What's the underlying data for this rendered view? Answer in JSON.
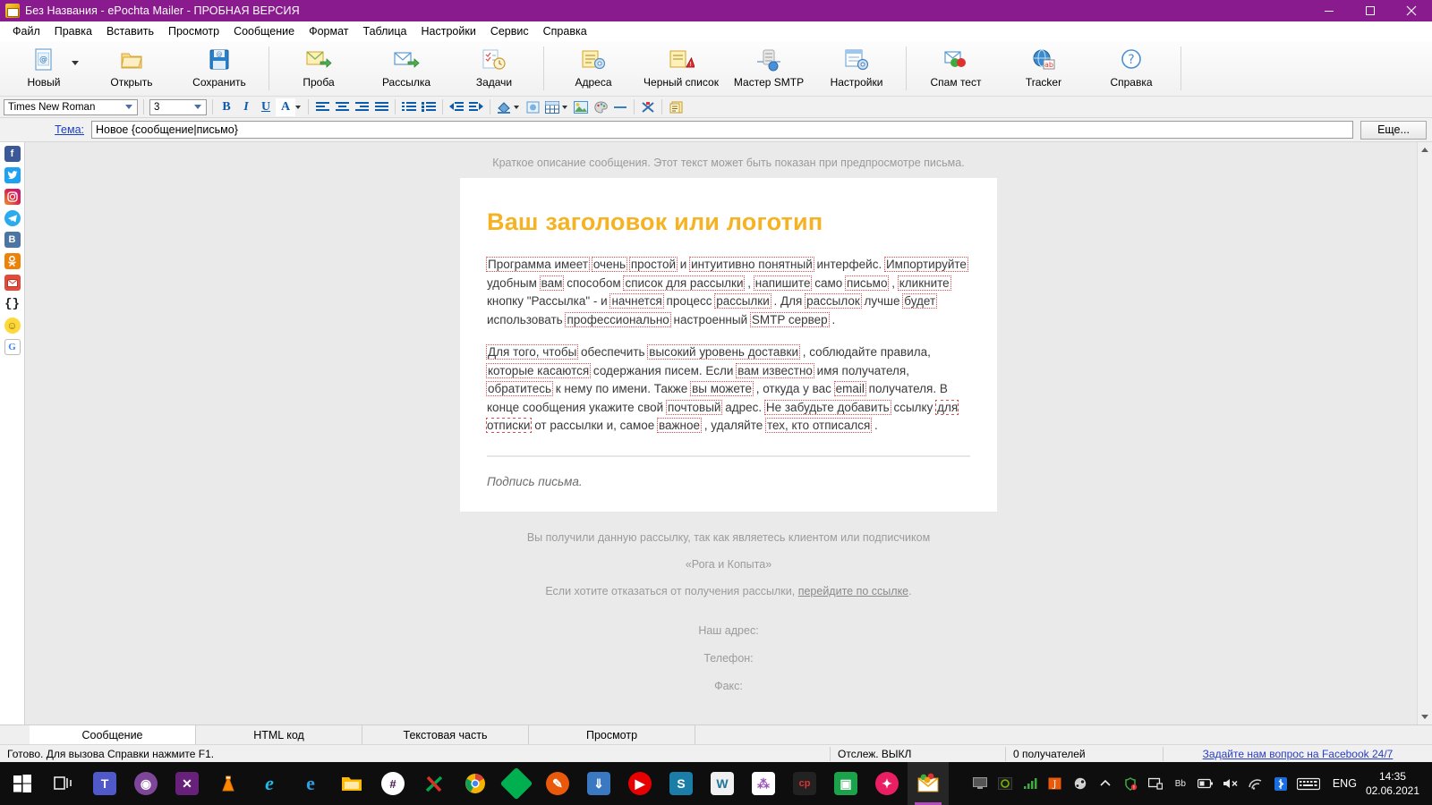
{
  "window": {
    "title": "Без Названия - ePochta Mailer - ПРОБНАЯ ВЕРСИЯ",
    "accent_color": "#8a1b8e",
    "minimize_label": "—",
    "maximize_label": "▢",
    "close_label": "✕"
  },
  "menu": {
    "items": [
      {
        "label": "Файл"
      },
      {
        "label": "Правка"
      },
      {
        "label": "Вставить"
      },
      {
        "label": "Просмотр"
      },
      {
        "label": "Сообщение"
      },
      {
        "label": "Формат"
      },
      {
        "label": "Таблица"
      },
      {
        "label": "Настройки"
      },
      {
        "label": "Сервис"
      },
      {
        "label": "Справка"
      }
    ]
  },
  "toolbar": {
    "groups": [
      {
        "items": [
          {
            "label": "Новый",
            "icon": "new-document-icon",
            "has_dropdown": true
          },
          {
            "label": "Открыть",
            "icon": "open-folder-icon",
            "has_dropdown": false
          },
          {
            "label": "Сохранить",
            "icon": "save-diskette-icon",
            "has_dropdown": false
          }
        ]
      },
      {
        "items": [
          {
            "label": "Проба",
            "icon": "test-send-icon",
            "has_dropdown": false
          },
          {
            "label": "Рассылка",
            "icon": "send-envelope-icon",
            "has_dropdown": false
          },
          {
            "label": "Задачи",
            "icon": "tasks-clock-icon",
            "has_dropdown": false
          }
        ]
      },
      {
        "items": [
          {
            "label": "Адреса",
            "icon": "address-book-icon",
            "has_dropdown": false
          },
          {
            "label": "Черный список",
            "icon": "blacklist-warning-icon",
            "has_dropdown": false
          },
          {
            "label": "Мастер SMTP",
            "icon": "smtp-server-icon",
            "has_dropdown": false
          },
          {
            "label": "Настройки",
            "icon": "settings-gear-icon",
            "has_dropdown": false
          }
        ]
      },
      {
        "items": [
          {
            "label": "Спам тест",
            "icon": "spam-test-icon",
            "has_dropdown": false
          },
          {
            "label": "Tracker",
            "icon": "tracker-globe-icon",
            "has_dropdown": false
          },
          {
            "label": "Справка",
            "icon": "help-question-icon",
            "has_dropdown": false
          }
        ]
      }
    ]
  },
  "format_toolbar": {
    "font_family": "Times New Roman",
    "font_size": "3",
    "buttons": [
      {
        "name": "bold-button",
        "glyph": "B",
        "title": "Жирный"
      },
      {
        "name": "italic-button",
        "glyph": "I",
        "title": "Курсив"
      },
      {
        "name": "underline-button",
        "glyph": "U",
        "title": "Подчеркнутый"
      },
      {
        "name": "font-color-button",
        "glyph": "A",
        "title": "Цвет текста"
      },
      {
        "name": "align-left-button",
        "glyph": "≡",
        "title": "По левому краю"
      },
      {
        "name": "align-center-button",
        "glyph": "≡",
        "title": "По центру"
      },
      {
        "name": "align-right-button",
        "glyph": "≡",
        "title": "По правому краю"
      },
      {
        "name": "align-justify-button",
        "glyph": "≡",
        "title": "По ширине"
      },
      {
        "name": "ordered-list-button",
        "glyph": "1.",
        "title": "Нумерованный список"
      },
      {
        "name": "unordered-list-button",
        "glyph": "•",
        "title": "Маркированный список"
      },
      {
        "name": "outdent-button",
        "glyph": "⇤",
        "title": "Уменьшить отступ"
      },
      {
        "name": "indent-button",
        "glyph": "⇥",
        "title": "Увеличить отступ"
      },
      {
        "name": "fill-color-button",
        "glyph": "◣",
        "title": "Заливка"
      },
      {
        "name": "insert-link-button",
        "glyph": "🔗",
        "title": "Ссылка"
      },
      {
        "name": "insert-table-button",
        "glyph": "▦",
        "title": "Таблица"
      },
      {
        "name": "insert-image-button",
        "glyph": "🖼",
        "title": "Изображение"
      },
      {
        "name": "palette-button",
        "glyph": "🎨",
        "title": "Палитра"
      },
      {
        "name": "horizontal-rule-button",
        "glyph": "—",
        "title": "Горизонтальная линия"
      },
      {
        "name": "clear-format-button",
        "glyph": "✂",
        "title": "Очистить форматирование"
      },
      {
        "name": "paste-template-button",
        "glyph": "▤",
        "title": "Шаблон"
      }
    ]
  },
  "subject": {
    "label": "Тема:",
    "value": "Новое {сообщение|письмо}",
    "placeholder": "",
    "more_button": "Еще..."
  },
  "social_sidebar": {
    "items": [
      {
        "name": "facebook-icon",
        "glyph": "f",
        "title": "Facebook"
      },
      {
        "name": "twitter-icon",
        "glyph": "t",
        "title": "Twitter"
      },
      {
        "name": "instagram-icon",
        "glyph": "◉",
        "title": "Instagram"
      },
      {
        "name": "telegram-icon",
        "glyph": "➤",
        "title": "Telegram"
      },
      {
        "name": "vk-icon",
        "glyph": "B",
        "title": "ВКонтакте"
      },
      {
        "name": "odnoklassniki-icon",
        "glyph": "ok",
        "title": "Одноклассники"
      },
      {
        "name": "email-icon",
        "glyph": "✉",
        "title": "E-mail"
      },
      {
        "name": "braces-icon",
        "glyph": "{}",
        "title": "Макросы"
      },
      {
        "name": "smiley-icon",
        "glyph": "☺",
        "title": "Смайлы"
      },
      {
        "name": "google-icon",
        "glyph": "G",
        "title": "Google"
      }
    ]
  },
  "message": {
    "preheader": "Краткое описание сообщения. Этот текст может быть показан при предпросмотре письма.",
    "heading": "Ваш заголовок или логотип",
    "heading_color": "#f5b324",
    "paragraph1": [
      {
        "t": "Программа имеет",
        "spin": true
      },
      {
        "t": " ",
        "spin": false
      },
      {
        "t": "очень",
        "spin": true
      },
      {
        "t": " ",
        "spin": false
      },
      {
        "t": "простой",
        "spin": true
      },
      {
        "t": " и ",
        "spin": false
      },
      {
        "t": "интуитивно понятный",
        "spin": true
      },
      {
        "t": " интерфейс. ",
        "spin": false
      },
      {
        "t": "Импортируйте",
        "spin": true
      },
      {
        "t": " удобным ",
        "spin": false
      },
      {
        "t": "вам",
        "spin": true
      },
      {
        "t": " способом ",
        "spin": false
      },
      {
        "t": "список для рассылки",
        "spin": true
      },
      {
        "t": " , ",
        "spin": false
      },
      {
        "t": "напишите",
        "spin": true
      },
      {
        "t": " само ",
        "spin": false
      },
      {
        "t": "письмо",
        "spin": true
      },
      {
        "t": " , ",
        "spin": false
      },
      {
        "t": "кликните",
        "spin": true
      },
      {
        "t": " кнопку \"Рассылка\" - и ",
        "spin": false
      },
      {
        "t": "начнется",
        "spin": true
      },
      {
        "t": " процесс ",
        "spin": false
      },
      {
        "t": "рассылки",
        "spin": true
      },
      {
        "t": " . Для ",
        "spin": false
      },
      {
        "t": "рассылок",
        "spin": true
      },
      {
        "t": " лучше ",
        "spin": false
      },
      {
        "t": "будет",
        "spin": true
      },
      {
        "t": " использовать ",
        "spin": false
      },
      {
        "t": "профессионально",
        "spin": true
      },
      {
        "t": " настроенный ",
        "spin": false
      },
      {
        "t": "SMTP сервер",
        "spin": true
      },
      {
        "t": " .",
        "spin": false
      }
    ],
    "paragraph2": [
      {
        "t": "Для того, чтобы",
        "spin": true
      },
      {
        "t": " обеспечить ",
        "spin": false
      },
      {
        "t": "высокий уровень доставки",
        "spin": true
      },
      {
        "t": " , соблюдайте правила, ",
        "spin": false
      },
      {
        "t": "которые касаются",
        "spin": true
      },
      {
        "t": " содержания писем. Если ",
        "spin": false
      },
      {
        "t": "вам известно",
        "spin": true
      },
      {
        "t": " имя получателя, ",
        "spin": false
      },
      {
        "t": "обратитесь",
        "spin": true
      },
      {
        "t": " к нему по имени. Также ",
        "spin": false
      },
      {
        "t": "вы можете",
        "spin": true
      },
      {
        "t": " , откуда у вас ",
        "spin": false
      },
      {
        "t": "email",
        "spin": true
      },
      {
        "t": " получателя. В конце сообщения укажите свой ",
        "spin": false
      },
      {
        "t": "почтовый",
        "spin": true
      },
      {
        "t": " адрес. ",
        "spin": false
      },
      {
        "t": "Не забудьте добавить",
        "spin": true
      },
      {
        "t": " ссылку ",
        "spin": false
      },
      {
        "t": "для отписки",
        "spin": true
      },
      {
        "t": " от рассылки и, самое ",
        "spin": false
      },
      {
        "t": "важное",
        "spin": true
      },
      {
        "t": " , удаляйте ",
        "spin": false
      },
      {
        "t": "тех, кто отписался",
        "spin": true
      },
      {
        "t": " .",
        "spin": false
      }
    ],
    "signature": "Подпись письма.",
    "footer_line1": "Вы получили данную рассылку, так как являетесь клиентом или подписчиком",
    "footer_line2": "«Рога и Копыта»",
    "footer_line3_prefix": "Если хотите отказаться от получения рассылки, ",
    "footer_line3_link": "перейдите по ссылке",
    "footer_line3_suffix": ".",
    "contact_address": "Наш адрес:",
    "contact_phone": "Телефон:",
    "contact_fax": "Факс:"
  },
  "tabs": [
    {
      "label": "Сообщение",
      "active": true
    },
    {
      "label": "HTML код",
      "active": false
    },
    {
      "label": "Текстовая часть",
      "active": false
    },
    {
      "label": "Просмотр",
      "active": false
    }
  ],
  "statusbar": {
    "hint": "Готово. Для вызова Справки нажмите F1.",
    "tracking": "Отслеж. ВЫКЛ",
    "recipients": "0 получателей",
    "support_link": "Задайте нам вопрос на Facebook 24/7"
  },
  "taskbar": {
    "items": [
      {
        "name": "start-button-icon",
        "glyph": "⊞",
        "color": "#ffffff",
        "bg": "transparent",
        "active": false
      },
      {
        "name": "task-view-icon",
        "glyph": "❏",
        "color": "#e8e8e8",
        "bg": "transparent",
        "active": false
      },
      {
        "name": "microsoft-teams-icon",
        "glyph": "T",
        "color": "#ffffff",
        "bg": "#5059c9",
        "active": false
      },
      {
        "name": "tor-browser-icon",
        "glyph": "◉",
        "color": "#ffffff",
        "bg": "#7d4698",
        "active": false
      },
      {
        "name": "visual-studio-icon",
        "glyph": "✕",
        "color": "#ffffff",
        "bg": "#68217a",
        "active": false
      },
      {
        "name": "vlc-player-icon",
        "glyph": "▲",
        "color": "#ffffff",
        "bg": "#ff8800",
        "active": false
      },
      {
        "name": "internet-explorer-icon",
        "glyph": "e",
        "color": "#ffffff",
        "bg": "#1ebbee",
        "active": false
      },
      {
        "name": "microsoft-edge-icon",
        "glyph": "e",
        "color": "#ffffff",
        "bg": "#0078d7",
        "active": false
      },
      {
        "name": "file-explorer-icon",
        "glyph": "🗀",
        "color": "#ffffff",
        "bg": "#ffb900",
        "active": false
      },
      {
        "name": "slack-icon",
        "glyph": "#",
        "color": "#ffffff",
        "bg": "#4a154b",
        "active": false
      },
      {
        "name": "xsplit-icon",
        "glyph": "✗",
        "color": "#ffffff",
        "bg": "#00a650",
        "active": false
      },
      {
        "name": "google-chrome-icon",
        "glyph": "◎",
        "color": "#ffffff",
        "bg": "#4285f4",
        "active": false
      },
      {
        "name": "green-app-icon",
        "glyph": "◆",
        "color": "#ffffff",
        "bg": "#00b050",
        "active": false
      },
      {
        "name": "orange-app-icon",
        "glyph": "✎",
        "color": "#ffffff",
        "bg": "#e8590c",
        "active": false
      },
      {
        "name": "downloads-icon",
        "glyph": "⇓",
        "color": "#ffffff",
        "bg": "#3b78c2",
        "active": false
      },
      {
        "name": "media-player-icon",
        "glyph": "▶",
        "color": "#ffffff",
        "bg": "#e60000",
        "active": false
      },
      {
        "name": "screenpresso-icon",
        "glyph": "S",
        "color": "#ffffff",
        "bg": "#1b7ea8",
        "active": false
      },
      {
        "name": "wordpress-icon",
        "glyph": "W",
        "color": "#ffffff",
        "bg": "#21759b",
        "active": false
      },
      {
        "name": "network-app-icon",
        "glyph": "⁂",
        "color": "#ffffff",
        "bg": "#9b59b6",
        "active": false
      },
      {
        "name": "cp-app-icon",
        "glyph": "cp",
        "color": "#ffffff",
        "bg": "#d93025",
        "active": false
      },
      {
        "name": "video-app-icon",
        "glyph": "▣",
        "color": "#ffffff",
        "bg": "#1aa34a",
        "active": false
      },
      {
        "name": "rocket-app-icon",
        "glyph": "✦",
        "color": "#ffffff",
        "bg": "#e91e63",
        "active": false
      },
      {
        "name": "epochta-mailer-icon",
        "glyph": "✉",
        "color": "#ffffff",
        "bg": "#f0a30a",
        "active": true
      }
    ],
    "tray": [
      {
        "name": "monitor-icon",
        "glyph": "🖵"
      },
      {
        "name": "nvidia-icon",
        "glyph": "◉"
      },
      {
        "name": "signal-icon",
        "glyph": "))"
      },
      {
        "name": "java-icon",
        "glyph": "J"
      },
      {
        "name": "steam-icon",
        "glyph": "◕"
      },
      {
        "name": "arrow-icon",
        "glyph": "⌃"
      },
      {
        "name": "antivirus-alert-icon",
        "glyph": "◔"
      },
      {
        "name": "display-icon",
        "glyph": "🖳"
      },
      {
        "name": "bluetooth-audio-icon",
        "glyph": "Bb"
      },
      {
        "name": "battery-icon",
        "glyph": "▭"
      },
      {
        "name": "volume-muted-icon",
        "glyph": "🔇"
      },
      {
        "name": "wifi-icon",
        "glyph": "◞"
      },
      {
        "name": "bluetooth-icon",
        "glyph": "✲"
      },
      {
        "name": "keyboard-icon",
        "glyph": "⌨"
      }
    ],
    "language": "ENG",
    "time": "14:35",
    "date": "02.06.2021"
  }
}
